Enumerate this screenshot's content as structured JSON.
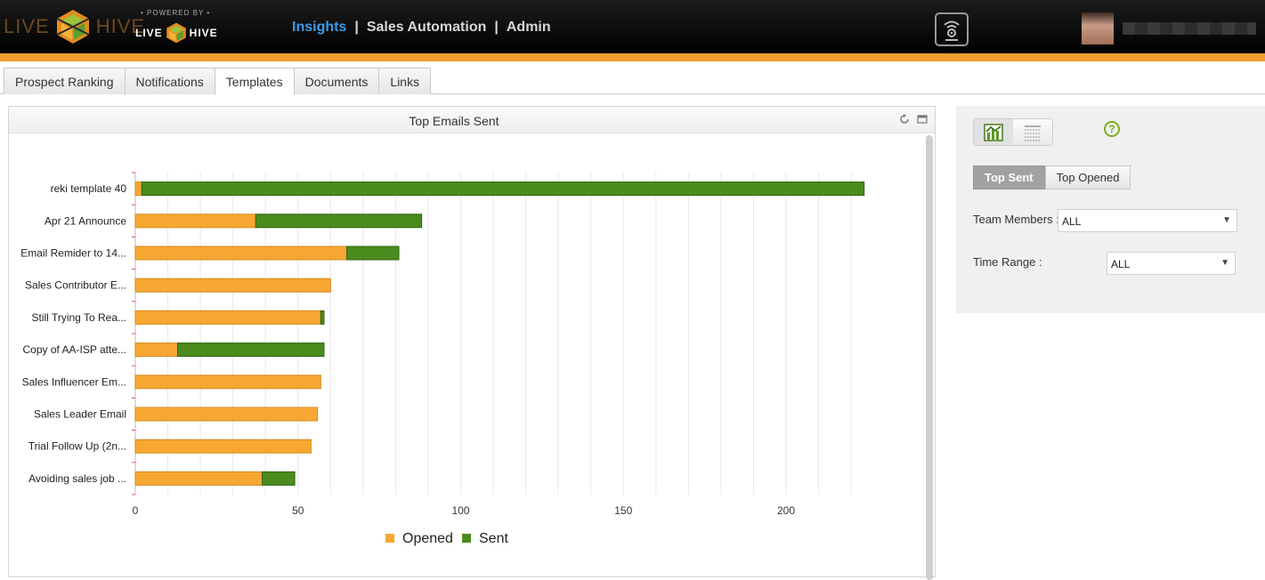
{
  "header": {
    "brand_left": "LIVE",
    "brand_right": "HIVE",
    "powered_label": "• POWERED BY •",
    "powered_left": "LIVE",
    "powered_right": "HIVE",
    "nav": [
      {
        "label": "Insights",
        "active": true
      },
      {
        "label": "Sales Automation",
        "active": false
      },
      {
        "label": "Admin",
        "active": false
      }
    ],
    "nav_separator": "|"
  },
  "tabs": [
    {
      "label": "Prospect Ranking",
      "active": false
    },
    {
      "label": "Notifications",
      "active": false
    },
    {
      "label": "Templates",
      "active": true
    },
    {
      "label": "Documents",
      "active": false
    },
    {
      "label": "Links",
      "active": false
    }
  ],
  "panel": {
    "title": "Top Emails Sent"
  },
  "chart_data": {
    "type": "bar",
    "orientation": "horizontal",
    "stacked": true,
    "title": "Top Emails Sent",
    "categories": [
      "reki template 40",
      "Apr 21 Announce",
      "Email Remider to 14...",
      "Sales Contributor E...",
      "Still Trying To Rea...",
      "Copy of AA-ISP atte...",
      "Sales Influencer Em...",
      "Sales Leader Email",
      "Trial Follow Up (2n...",
      "Avoiding sales job ..."
    ],
    "series": [
      {
        "name": "Opened",
        "color": "#f7a833",
        "values": [
          2,
          37,
          65,
          60,
          57,
          13,
          57,
          56,
          54,
          39
        ]
      },
      {
        "name": "Sent",
        "color": "#4b8a1c",
        "values": [
          222,
          51,
          16,
          0,
          1,
          45,
          0,
          0,
          0,
          10
        ]
      }
    ],
    "xlim": [
      0,
      225
    ],
    "xticks": [
      "0",
      "50",
      "100",
      "150",
      "200"
    ],
    "legend_position": "bottom-center",
    "grid": true
  },
  "side": {
    "help": "?",
    "seg": [
      {
        "label": "Top Sent",
        "active": true
      },
      {
        "label": "Top Opened",
        "active": false
      }
    ],
    "team_label": "Team Members :",
    "team_value": "ALL",
    "time_label": "Time Range :",
    "time_value": "ALL",
    "arrow": "▼"
  }
}
